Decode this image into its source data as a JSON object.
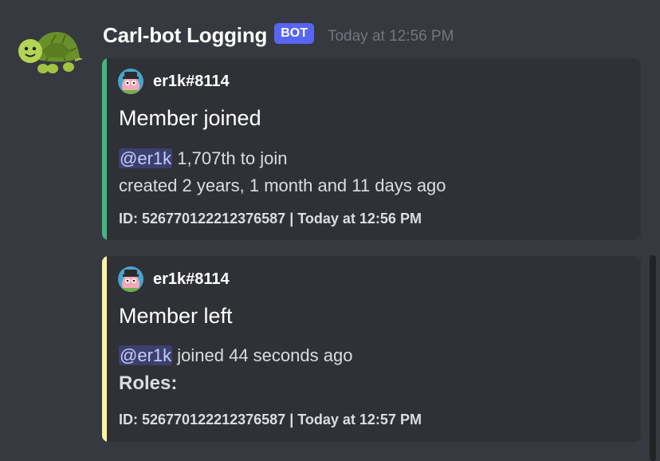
{
  "message": {
    "author": "Carl-bot Logging",
    "badge": "BOT",
    "timestamp": "Today at 12:56 PM",
    "avatar_icon": "turtle-icon"
  },
  "embeds": [
    {
      "accent_color": "#43b581",
      "author_name": "er1k#8114",
      "title": "Member joined",
      "mention": "@er1k",
      "line1_rest": " 1,707th to join",
      "line2": "created 2 years, 1 month and 11 days ago",
      "footer": "ID: 526770122212376587 | Today at 12:56 PM"
    },
    {
      "accent_color": "#faf3a0",
      "author_name": "er1k#8114",
      "title": "Member left",
      "mention": "@er1k",
      "line1_rest": " joined 44 seconds ago",
      "roles_label": "Roles:",
      "footer": "ID: 526770122212376587 | Today at 12:57 PM"
    }
  ],
  "colors": {
    "background": "#36393f",
    "embed_background": "#2f3136",
    "bot_badge": "#5865f2",
    "timestamp": "#72767d"
  }
}
